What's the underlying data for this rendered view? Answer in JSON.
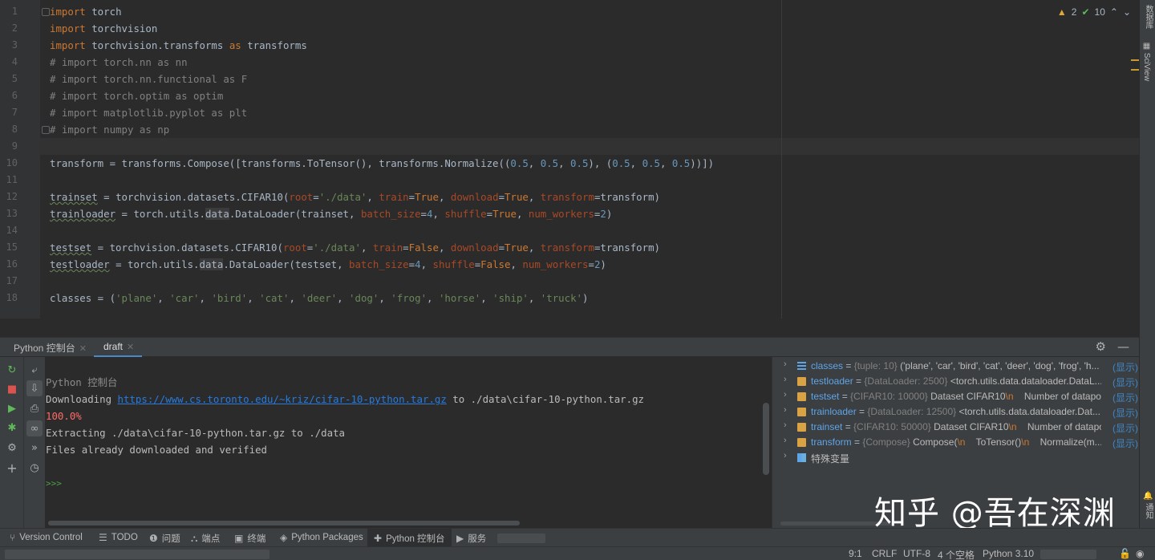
{
  "editor": {
    "line_numbers": [
      "1",
      "2",
      "3",
      "4",
      "5",
      "6",
      "7",
      "8",
      "9",
      "10",
      "11",
      "12",
      "13",
      "14",
      "15",
      "16",
      "17",
      "18"
    ],
    "inspections": {
      "warnings": "2",
      "ok": "10"
    }
  },
  "right_panel": {
    "top_label": "数据库",
    "sciview_label": "SciView",
    "notifications_label": "通知"
  },
  "console_tabs": [
    {
      "label": "Python 控制台"
    },
    {
      "label": "draft"
    }
  ],
  "console": {
    "lines": [
      "Python 控制台",
      "Downloading ",
      "https://www.cs.toronto.edu/~kriz/cifar-10-python.tar.gz",
      " to ./data\\cifar-10-python.tar.gz",
      "100.0%",
      "Extracting ./data\\cifar-10-python.tar.gz to ./data",
      "Files already downloaded and verified",
      ">>>"
    ]
  },
  "variables": {
    "show_label": "(显示)",
    "items": [
      {
        "name": "classes",
        "type": "{tuple: 10}",
        "value": "('plane', 'car', 'bird', 'cat', 'deer', 'dog', 'frog', 'h...",
        "icon": "list-icon"
      },
      {
        "name": "testloader",
        "type": "{DataLoader: 2500}",
        "value": "<torch.utils.data.dataloader.DataL...",
        "icon": "object-icon"
      },
      {
        "name": "testset",
        "type": "{CIFAR10: 10000}",
        "value": "Dataset CIFAR10",
        "esc": "\\n",
        "tail": "    Number of datapoi...",
        "icon": "object-icon"
      },
      {
        "name": "trainloader",
        "type": "{DataLoader: 12500}",
        "value": "<torch.utils.data.dataloader.Dat...",
        "icon": "object-icon"
      },
      {
        "name": "trainset",
        "type": "{CIFAR10: 50000}",
        "value": "Dataset CIFAR10",
        "esc": "\\n",
        "tail": "    Number of datapo...",
        "icon": "object-icon"
      },
      {
        "name": "transform",
        "type": "{Compose}",
        "value": "Compose(",
        "esc": "\\n",
        "tail": "    ToTensor()",
        "esc2": "\\n",
        "tail2": "    Normalize(m...",
        "icon": "object-icon"
      }
    ],
    "special": "特殊变量"
  },
  "watermark": "知乎 @吾在深渊",
  "bottom_tools": [
    {
      "label": "Version Control",
      "icon": "branch-icon"
    },
    {
      "label": "TODO",
      "icon": "todo-icon"
    },
    {
      "label": "问题",
      "icon": "problems-icon"
    },
    {
      "label": "端点",
      "icon": "endpoints-icon"
    },
    {
      "label": "终端",
      "icon": "terminal-icon"
    },
    {
      "label": "Python Packages",
      "icon": "packages-icon"
    },
    {
      "label": "Python 控制台",
      "icon": "python-console-icon"
    },
    {
      "label": "服务",
      "icon": "services-icon"
    }
  ],
  "status": {
    "position": "9:1",
    "line_sep": "CRLF",
    "encoding": "UTF-8",
    "indent": "4 个空格",
    "interpreter": "Python 3.10"
  },
  "colors": {
    "keyword": "#cc7832",
    "string": "#6a8759",
    "number": "#6897bb",
    "comment": "#808080",
    "link": "#287bde",
    "error": "#ff6b68"
  }
}
